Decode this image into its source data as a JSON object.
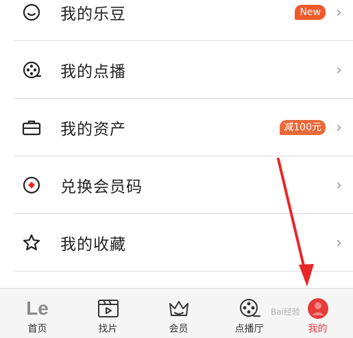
{
  "menu": {
    "items": [
      {
        "label": "我的乐豆",
        "badge": "New",
        "icon": "smile-icon"
      },
      {
        "label": "我的点播",
        "badge": "",
        "icon": "film-reel-icon"
      },
      {
        "label": "我的资产",
        "badge": "减100元",
        "icon": "briefcase-icon"
      },
      {
        "label": "兑换会员码",
        "badge": "",
        "icon": "coupon-icon"
      },
      {
        "label": "我的收藏",
        "badge": "",
        "icon": "star-icon"
      }
    ],
    "chevron": "›"
  },
  "tabbar": {
    "tabs": [
      {
        "label": "首页",
        "icon": "le-logo-icon",
        "logo_text": "Le"
      },
      {
        "label": "找片",
        "icon": "clapperboard-icon"
      },
      {
        "label": "会员",
        "icon": "crown-icon"
      },
      {
        "label": "点播厅",
        "icon": "film-reel-icon"
      },
      {
        "label": "我的",
        "icon": "avatar-icon",
        "active": true
      }
    ]
  },
  "annotation": {
    "arrow_color": "#e8272a"
  },
  "watermark": "Bai经验",
  "colors": {
    "accent": "#e63b3b",
    "badge": "#ef5a2c"
  }
}
